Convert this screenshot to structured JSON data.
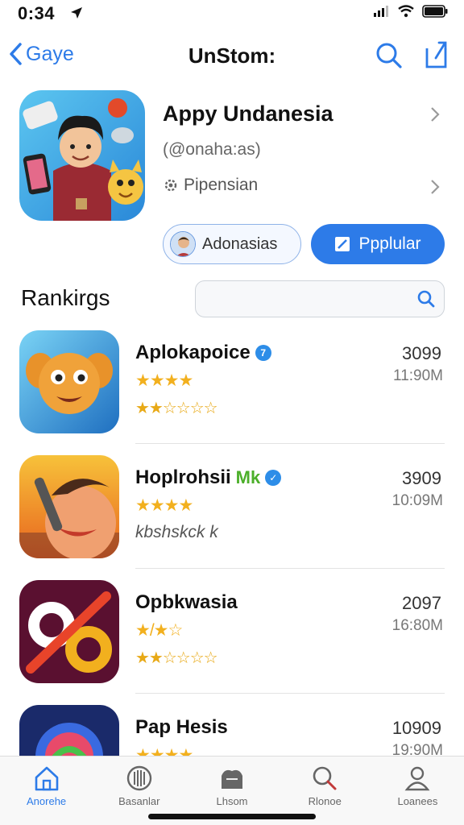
{
  "status": {
    "time": "0:34"
  },
  "nav": {
    "back_label": "Gaye",
    "title": "UnStom:"
  },
  "hero": {
    "title": "Appy Undanesia",
    "subtitle": "(@onaha:as)",
    "category": "Pipensian",
    "pill_outline_label": "Adonasias",
    "pill_primary_label": "Ppplular"
  },
  "rankings": {
    "title": "Rankirgs",
    "search_value": ""
  },
  "apps": [
    {
      "name": "Aplokapoice",
      "badge": "7",
      "rank": "3099",
      "size": "11:90M",
      "stars_top": "★★★★",
      "stars_bottom": "★★☆☆☆☆"
    },
    {
      "name": "Hoplrohsii",
      "badge_text": "Mk",
      "rank": "3909",
      "size": "10:09M",
      "stars_top": "★★★★",
      "subtext": "kbshskck k"
    },
    {
      "name": "Opbkwasia",
      "rank": "2097",
      "size": "16:80M",
      "stars_top": "★/★☆",
      "stars_bottom": "★★☆☆☆☆"
    },
    {
      "name": "Pap Hesis",
      "rank": "10909",
      "size": "19:90M",
      "stars_top": "★★★★"
    }
  ],
  "tabs": [
    {
      "label": "Anorehe",
      "icon": "home-icon"
    },
    {
      "label": "Basanlar",
      "icon": "globe-icon"
    },
    {
      "label": "Lhsom",
      "icon": "cloud-icon"
    },
    {
      "label": "Rlonoe",
      "icon": "search-icon"
    },
    {
      "label": "Loanees",
      "icon": "person-icon"
    }
  ],
  "colors": {
    "accent": "#2d7be8",
    "star": "#f2b01e"
  }
}
